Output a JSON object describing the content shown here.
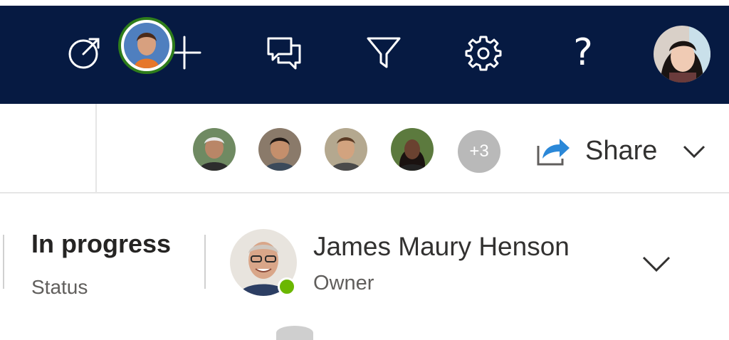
{
  "nav": {
    "icons": [
      "target-icon",
      "plus-icon",
      "chat-icon",
      "filter-icon",
      "gear-icon",
      "help-icon"
    ],
    "help_glyph": "?",
    "colors": {
      "bar": "#061a42",
      "icon": "#ffffff"
    }
  },
  "collaborators": {
    "more_count": "+3",
    "active_ring_color": "#2e7d1b"
  },
  "share": {
    "label": "Share",
    "accent": "#2b88d8"
  },
  "record": {
    "status_value": "In progress",
    "status_label": "Status",
    "owner_name": "James Maury Henson",
    "owner_label": "Owner",
    "presence_color": "#6bb700"
  }
}
